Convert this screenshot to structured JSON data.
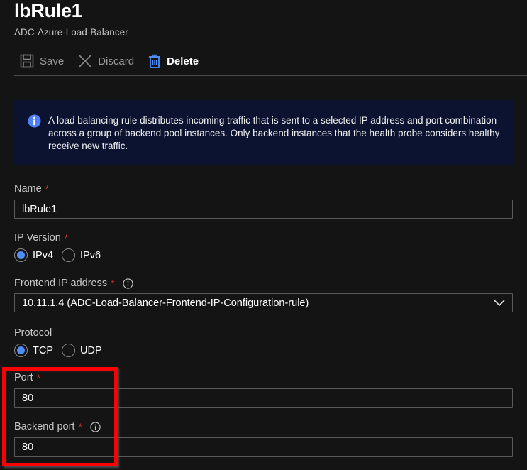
{
  "header": {
    "title": "lbRule1",
    "subtitle": "ADC-Azure-Load-Balancer"
  },
  "toolbar": {
    "save_label": "Save",
    "discard_label": "Discard",
    "delete_label": "Delete"
  },
  "banner": {
    "icon": "info-icon",
    "text": "A load balancing rule distributes incoming traffic that is sent to a selected IP address and port combination across a group of backend pool instances. Only backend instances that the health probe considers healthy receive new traffic."
  },
  "form": {
    "name": {
      "label": "Name",
      "required": "*",
      "value": "lbRule1"
    },
    "ip_version": {
      "label": "IP Version",
      "required": "*",
      "options": [
        {
          "label": "IPv4",
          "selected": true
        },
        {
          "label": "IPv6",
          "selected": false
        }
      ]
    },
    "frontend_ip": {
      "label": "Frontend IP address",
      "required": "*",
      "value": "10.11.1.4 (ADC-Load-Balancer-Frontend-IP-Configuration-rule)"
    },
    "protocol": {
      "label": "Protocol",
      "options": [
        {
          "label": "TCP",
          "selected": true
        },
        {
          "label": "UDP",
          "selected": false
        }
      ]
    },
    "port": {
      "label": "Port",
      "required": "*",
      "value": "80"
    },
    "backend_port": {
      "label": "Backend port",
      "required": "*",
      "value": "80"
    }
  },
  "colors": {
    "background": "#141414",
    "banner": "#0b1330",
    "accent": "#4f8ef7",
    "required": "#d13438",
    "highlight": "#ff0000"
  }
}
